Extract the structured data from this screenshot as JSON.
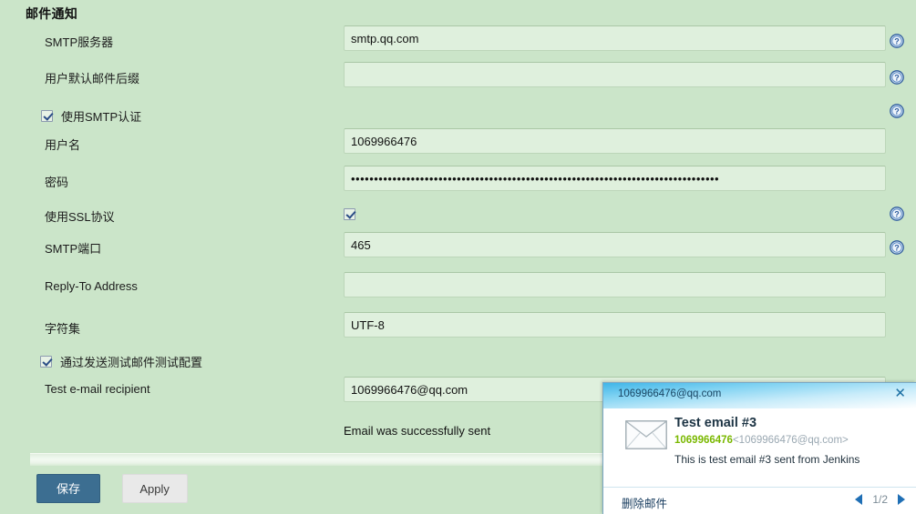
{
  "section": {
    "title": "邮件通知"
  },
  "fields": {
    "smtp_server": {
      "label": "SMTP服务器",
      "value": "smtp.qq.com",
      "placeholder": ""
    },
    "default_suffix": {
      "label": "用户默认邮件后缀",
      "value": "",
      "placeholder": ""
    },
    "use_smtp_auth": {
      "label": "使用SMTP认证",
      "checked": true
    },
    "username": {
      "label": "用户名",
      "value": "1069966476",
      "placeholder": ""
    },
    "password": {
      "label": "密码",
      "value": "••••••••••••••••••••••••••••••••••••••••••••••••••••••••••••••••••••••••••••••••",
      "placeholder": ""
    },
    "use_ssl": {
      "label": "使用SSL协议",
      "checked": true
    },
    "smtp_port": {
      "label": "SMTP端口",
      "value": "465",
      "placeholder": ""
    },
    "reply_to": {
      "label": "Reply-To Address",
      "value": "",
      "placeholder": ""
    },
    "charset": {
      "label": "字符集",
      "value": "UTF-8",
      "placeholder": ""
    },
    "test_config": {
      "label": "通过发送测试邮件测试配置",
      "checked": true
    },
    "test_recipient": {
      "label": "Test e-mail recipient",
      "value": "1069966476@qq.com",
      "placeholder": ""
    }
  },
  "status": {
    "send_result": "Email was successfully sent"
  },
  "buttons": {
    "save": "保存",
    "apply": "Apply"
  },
  "icons": {
    "help": "help-icon",
    "close": "✕"
  },
  "popup": {
    "account": "1069966476@qq.com",
    "subject": "Test email #3",
    "from_name": "1069966476",
    "from_email": "<1069966476@qq.com>",
    "snippet": "This is test email #3 sent from Jenkins",
    "delete_label": "删除邮件",
    "pager": "1/2"
  },
  "colors": {
    "page_bg": "#cbe5c9",
    "input_bg": "#dff0dd",
    "primary_button": "#3c6e91",
    "accent_green": "#7ab800",
    "popup_header": "#3fb5e8"
  }
}
